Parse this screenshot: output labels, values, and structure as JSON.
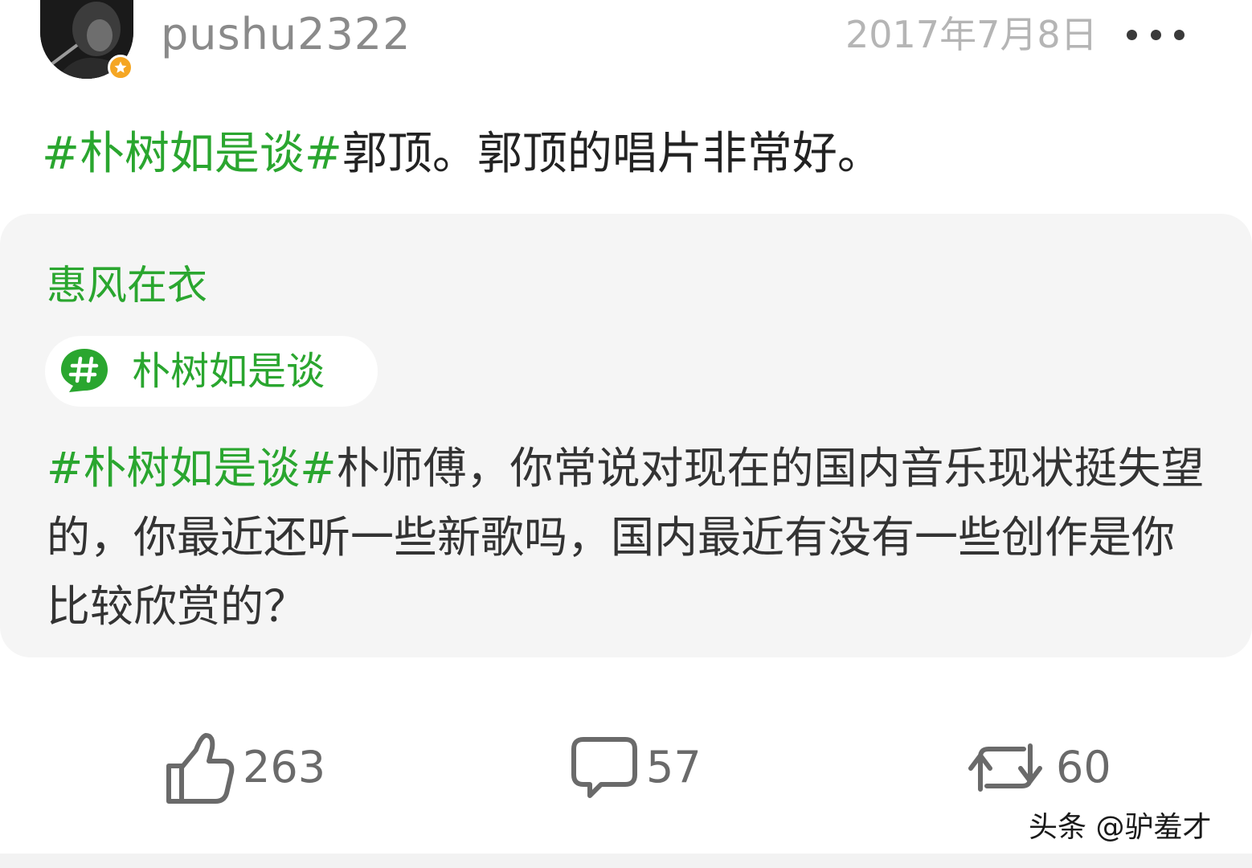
{
  "post": {
    "username": "pushu2322",
    "date": "2017年7月8日",
    "hashtag": "#朴树如是谈#",
    "text": "郭顶。郭顶的唱片非常好。"
  },
  "quote": {
    "author": "惠风在衣",
    "topic_label": "朴树如是谈",
    "hashtag": "#朴树如是谈#",
    "text": "朴师傅，你常说对现在的国内音乐现状挺失望的，你最近还听一些新歌吗，国内最近有没有一些创作是你比较欣赏的？"
  },
  "actions": {
    "likes": "263",
    "comments": "57",
    "reposts": "60"
  },
  "watermark": {
    "text": "头条 @驴羞才"
  },
  "icons": {
    "more": "more-dots-icon",
    "badge": "star-badge-icon",
    "topic": "hashtag-bubble-icon",
    "like": "thumbs-up-icon",
    "comment": "comment-bubble-icon",
    "repost": "repost-arrows-icon"
  },
  "colors": {
    "accent_green": "#2aa62f",
    "badge_orange": "#f5a623",
    "card_background": "#f5f5f5",
    "muted_text": "#8a8a8a"
  }
}
